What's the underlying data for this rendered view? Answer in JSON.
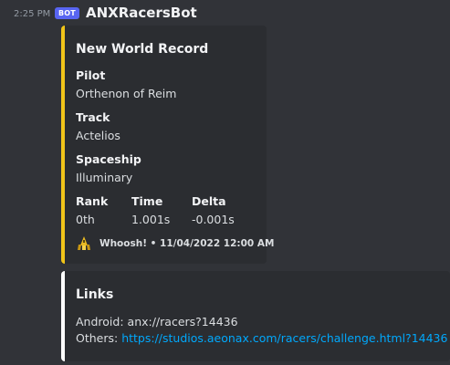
{
  "message": {
    "timestamp": "2:25 PM",
    "bot_badge": "BOT",
    "username": "ANXRacersBot"
  },
  "embed_record": {
    "accent_color": "#f0c419",
    "title": "New World Record",
    "fields": {
      "pilot": {
        "name": "Pilot",
        "value": "Orthenon of Reim"
      },
      "track": {
        "name": "Track",
        "value": "Actelios"
      },
      "spaceship": {
        "name": "Spaceship",
        "value": "Illuminary"
      },
      "rank": {
        "name": "Rank",
        "value": "0th"
      },
      "time": {
        "name": "Time",
        "value": "1.001s"
      },
      "delta": {
        "name": "Delta",
        "value": "-0.001s"
      }
    },
    "footer": {
      "icon": "ship-icon",
      "text": "Whoosh! • 11/04/2022 12:00 AM"
    }
  },
  "embed_links": {
    "accent_color": "#ffffff",
    "title": "Links",
    "android_label": "Android:",
    "android_value": "anx://racers?14436",
    "others_label": "Others:",
    "others_link": "https://studios.aeonax.com/racers/challenge.html?14436"
  }
}
